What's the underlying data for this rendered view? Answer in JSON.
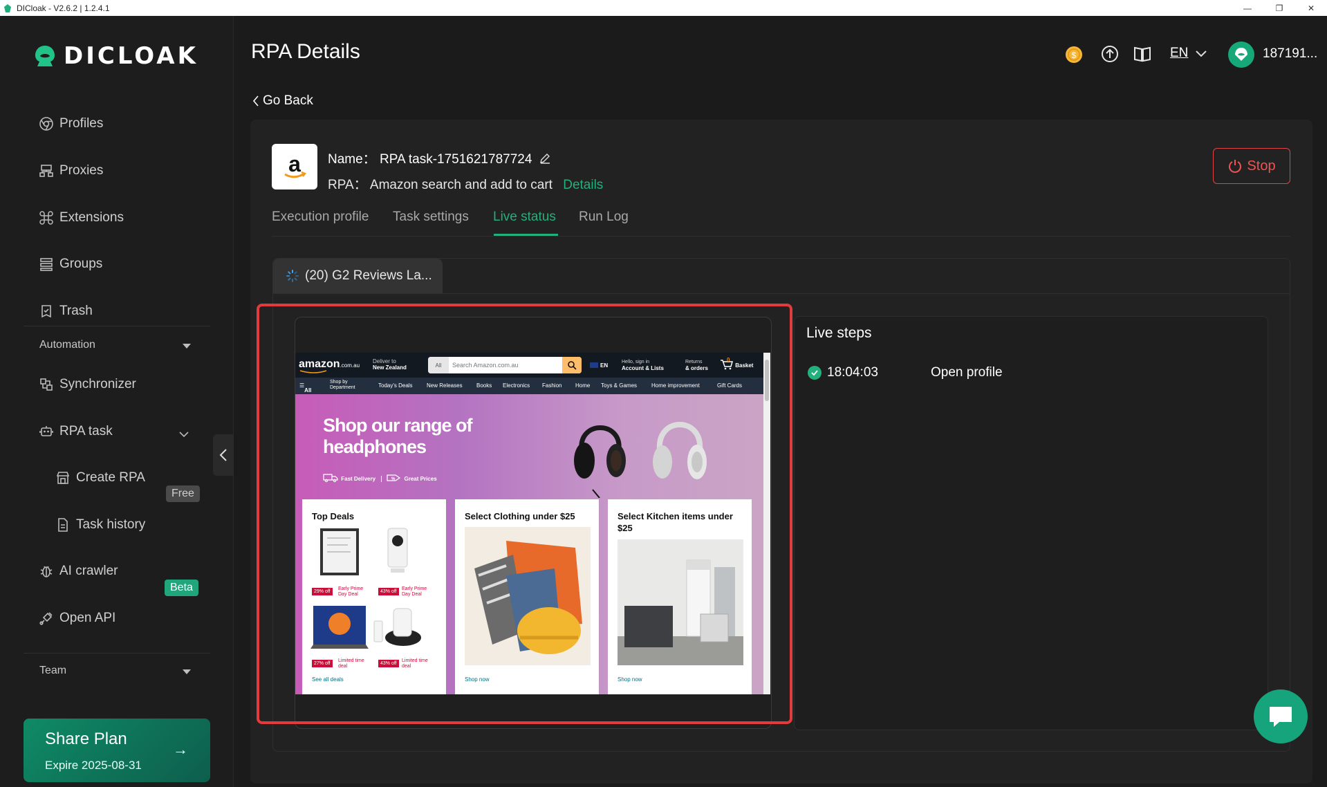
{
  "window": {
    "title": "DICloak - V2.6.2 | 1.2.4.1",
    "minimize": "—",
    "maximize": "❐",
    "close": "✕"
  },
  "brand": {
    "logo_text": "DICLOAK",
    "accent": "#22b07d"
  },
  "sidebar": {
    "items": [
      {
        "label": "Profiles",
        "icon": "chrome-icon"
      },
      {
        "label": "Proxies",
        "icon": "proxy-icon"
      },
      {
        "label": "Extensions",
        "icon": "command-icon"
      },
      {
        "label": "Groups",
        "icon": "groups-icon"
      },
      {
        "label": "Trash",
        "icon": "trash-icon"
      }
    ],
    "automation_label": "Automation",
    "automation_items": [
      {
        "label": "Synchronizer",
        "icon": "sync-icon"
      },
      {
        "label": "RPA task",
        "icon": "robot-icon"
      }
    ],
    "rpa_sub": [
      {
        "label": "Create RPA",
        "badge": "Free"
      },
      {
        "label": "Task history"
      }
    ],
    "extra_items": [
      {
        "label": "AI crawler",
        "badge": "Beta"
      },
      {
        "label": "Open API"
      }
    ],
    "team_label": "Team",
    "share_plan": {
      "title": "Share Plan",
      "expire": "Expire 2025-08-31",
      "arrow": "→"
    }
  },
  "header": {
    "title": "RPA Details",
    "lang": "EN",
    "user": "187191..."
  },
  "go_back": "Go Back",
  "task": {
    "name_label": "Name：",
    "name_value": "RPA task-1751621787724",
    "rpa_label": "RPA：",
    "rpa_value": "Amazon search and add to cart",
    "details_link": "Details",
    "stop_label": "Stop"
  },
  "tabs": [
    {
      "label": "Execution profile",
      "active": false
    },
    {
      "label": "Task settings",
      "active": false
    },
    {
      "label": "Live status",
      "active": true
    },
    {
      "label": "Run Log",
      "active": false
    }
  ],
  "profile_tab": "(20) G2 Reviews La...",
  "amazon": {
    "logo": "amazon",
    "logo_suffix": ".com.au",
    "deliver_to": "Deliver to",
    "deliver_region": "New Zealand",
    "search_cat": "All",
    "search_placeholder": "Search Amazon.com.au",
    "lang": "EN",
    "account_line1": "Hello, sign in",
    "account_line2": "Account & Lists",
    "returns_line1": "Returns",
    "returns_line2": "& orders",
    "cart_count": "0",
    "cart": "Basket",
    "nav": [
      "All",
      "Shop by Department",
      "Today's Deals",
      "New Releases",
      "Books",
      "Electronics",
      "Fashion",
      "Home",
      "Toys & Games",
      "Home improvement",
      "Gift Cards"
    ],
    "hero_title": "Shop our range of headphones",
    "hero_badge1": "Fast Delivery",
    "hero_badge2": "Great Prices",
    "cards": [
      {
        "title": "Top Deals",
        "footer": "See all deals"
      },
      {
        "title": "Select Clothing under $25",
        "footer": "Shop now"
      },
      {
        "title": "Select Kitchen items under $25",
        "footer": "Shop now"
      }
    ],
    "deals": [
      {
        "tag": "29% off",
        "text": "Early Prime Day Deal"
      },
      {
        "tag": "43% off",
        "text": "Early Prime Day Deal"
      },
      {
        "tag": "27% off",
        "text": "Limited time deal"
      },
      {
        "tag": "43% off",
        "text": "Limited time deal"
      }
    ]
  },
  "live_steps": {
    "title": "Live steps",
    "steps": [
      {
        "time": "18:04:03",
        "action": "Open profile"
      }
    ]
  }
}
